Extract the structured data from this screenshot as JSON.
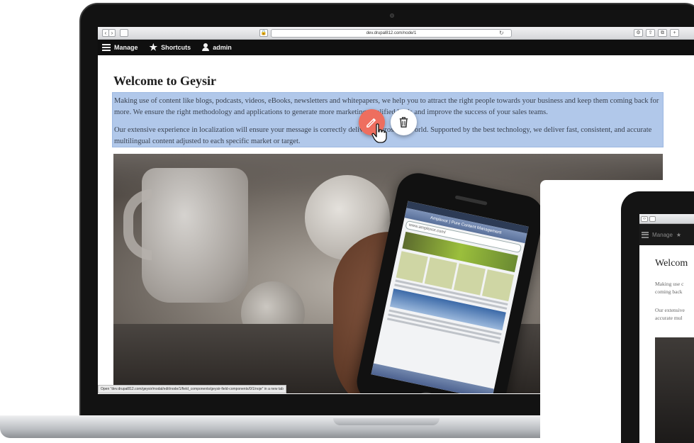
{
  "browser": {
    "url": "dev.drupal812.com/node/1",
    "back_glyph": "‹",
    "forward_glyph": "›",
    "reload_glyph": "↻",
    "lock_glyph": "🔒",
    "right_buttons": [
      "⚙",
      "⇪",
      "⧉",
      "+"
    ]
  },
  "toolbar": {
    "manage": "Manage",
    "shortcuts": "Shortcuts",
    "admin": "admin"
  },
  "page": {
    "title": "Welcome to Geysir",
    "paragraph1": "Making use of content like blogs, podcasts, videos, eBooks, newsletters and whitepapers, we help you to attract the right people towards your business and keep them coming back for more. We ensure the right methodology and applications to generate more marketing-qualified leads and improve the success of your sales teams.",
    "paragraph2": "Our extensive experience in localization will ensure your message is correctly delivered across the world. Supported by the best technology, we deliver fast, consistent, and accurate multilingual content adjusted to each specific market or target.",
    "status_url": "Open \"dev.drupal812.com/geysir/modal/edit/node/1/field_components/geysir-field-components/0/1/noje\" in a new tab"
  },
  "phone": {
    "title": "Amplexor | Pure Content Management",
    "url": "www.amplexor.com/"
  },
  "tablet": {
    "toolbar_manage": "Manage",
    "title": "Welcom",
    "line1": "Making use c",
    "line2": "coming back",
    "line3": "Our extensive",
    "line4": "accurate mul"
  },
  "colors": {
    "selection": "#b1c8ea",
    "edit_button": "#ee6e5f",
    "toolbar": "#0f0f0f"
  },
  "icons": {
    "edit": "pencil-icon",
    "delete": "trash-icon",
    "pointer": "hand-pointer-icon"
  }
}
